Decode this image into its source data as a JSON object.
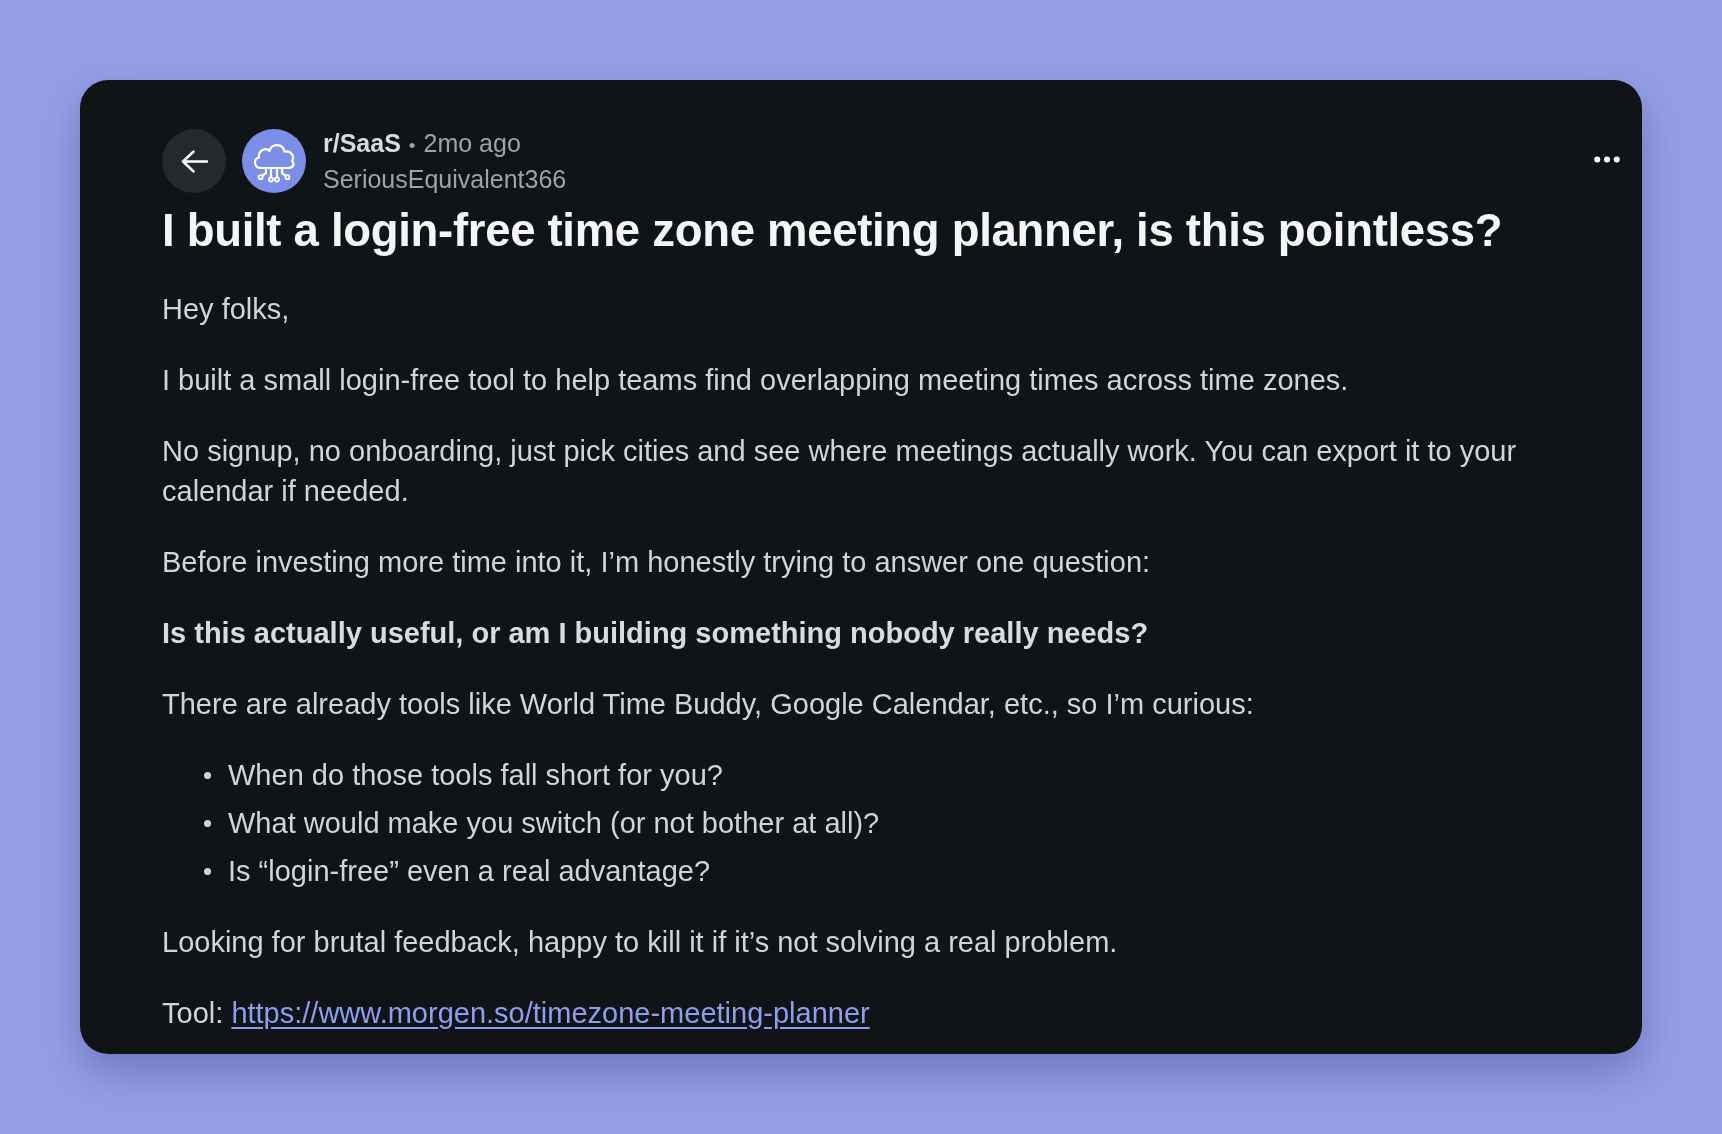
{
  "post": {
    "subreddit": "r/SaaS",
    "separator": "•",
    "time": "2mo ago",
    "author": "SeriousEquivalent366",
    "title": "I built a login-free time zone meeting planner, is this pointless?",
    "body": [
      {
        "kind": "paragraph",
        "text": "Hey folks,"
      },
      {
        "kind": "paragraph",
        "text": "I built a small login-free tool to help teams find overlapping meeting times across time zones."
      },
      {
        "kind": "paragraph",
        "text": "No signup, no onboarding, just pick cities and see where meetings actually work. You can export it to your calendar if needed."
      },
      {
        "kind": "paragraph",
        "text": "Before investing more time into it, I’m honestly trying to answer one question:"
      },
      {
        "kind": "strong",
        "text": "Is this actually useful, or am I building something nobody really needs?"
      },
      {
        "kind": "paragraph",
        "text": "There are already tools like World Time Buddy, Google Calendar, etc., so I’m curious:"
      },
      {
        "kind": "list",
        "items": [
          "When do those tools fall short for you?",
          "What would make you switch (or not bother at all)?",
          "Is “login-free” even a real advantage?"
        ]
      },
      {
        "kind": "paragraph",
        "text": "Looking for brutal feedback, happy to kill it if it’s not solving a real problem."
      },
      {
        "kind": "link",
        "label": "Tool:",
        "url": "https://www.morgen.so/timezone-meeting-planner"
      }
    ]
  }
}
